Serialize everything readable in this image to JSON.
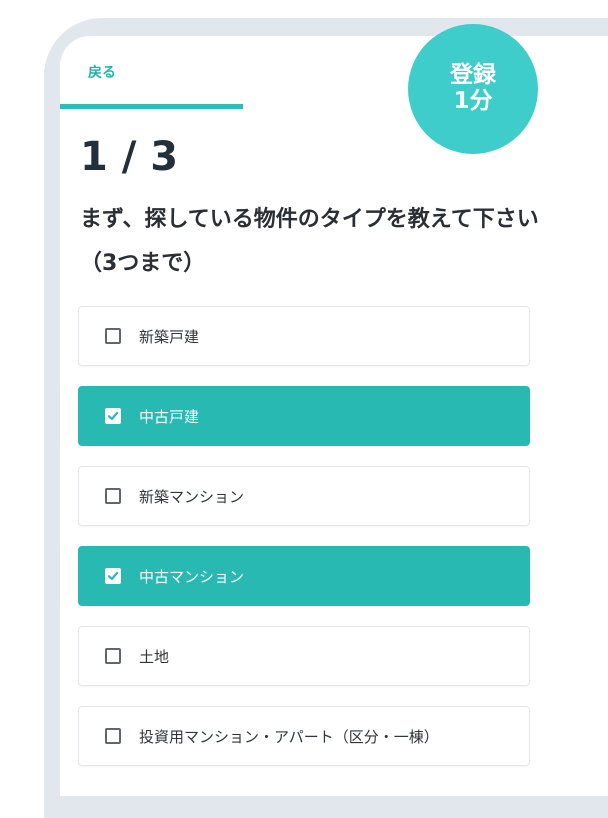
{
  "header": {
    "back_label": "戻る",
    "progress_fraction": 0.3333
  },
  "badge": {
    "line1": "登録",
    "line2": "1分"
  },
  "step": {
    "label": "1 / 3"
  },
  "question": {
    "text": "まず、探している物件のタイプを教えて下さい（3つまで）"
  },
  "options": [
    {
      "label": "新築戸建",
      "checked": false
    },
    {
      "label": "中古戸建",
      "checked": true
    },
    {
      "label": "新築マンション",
      "checked": false
    },
    {
      "label": "中古マンション",
      "checked": true
    },
    {
      "label": "土地",
      "checked": false
    },
    {
      "label": "投資用マンション・アパート（区分・一棟）",
      "checked": false
    }
  ],
  "colors": {
    "accent": "#2bbdb6",
    "badge": "#3ecdcb",
    "frame": "#e2e7ee",
    "text": "#2a2f36"
  },
  "icons": {
    "checkbox_checked": "check-icon",
    "checkbox_unchecked": "empty-box"
  }
}
